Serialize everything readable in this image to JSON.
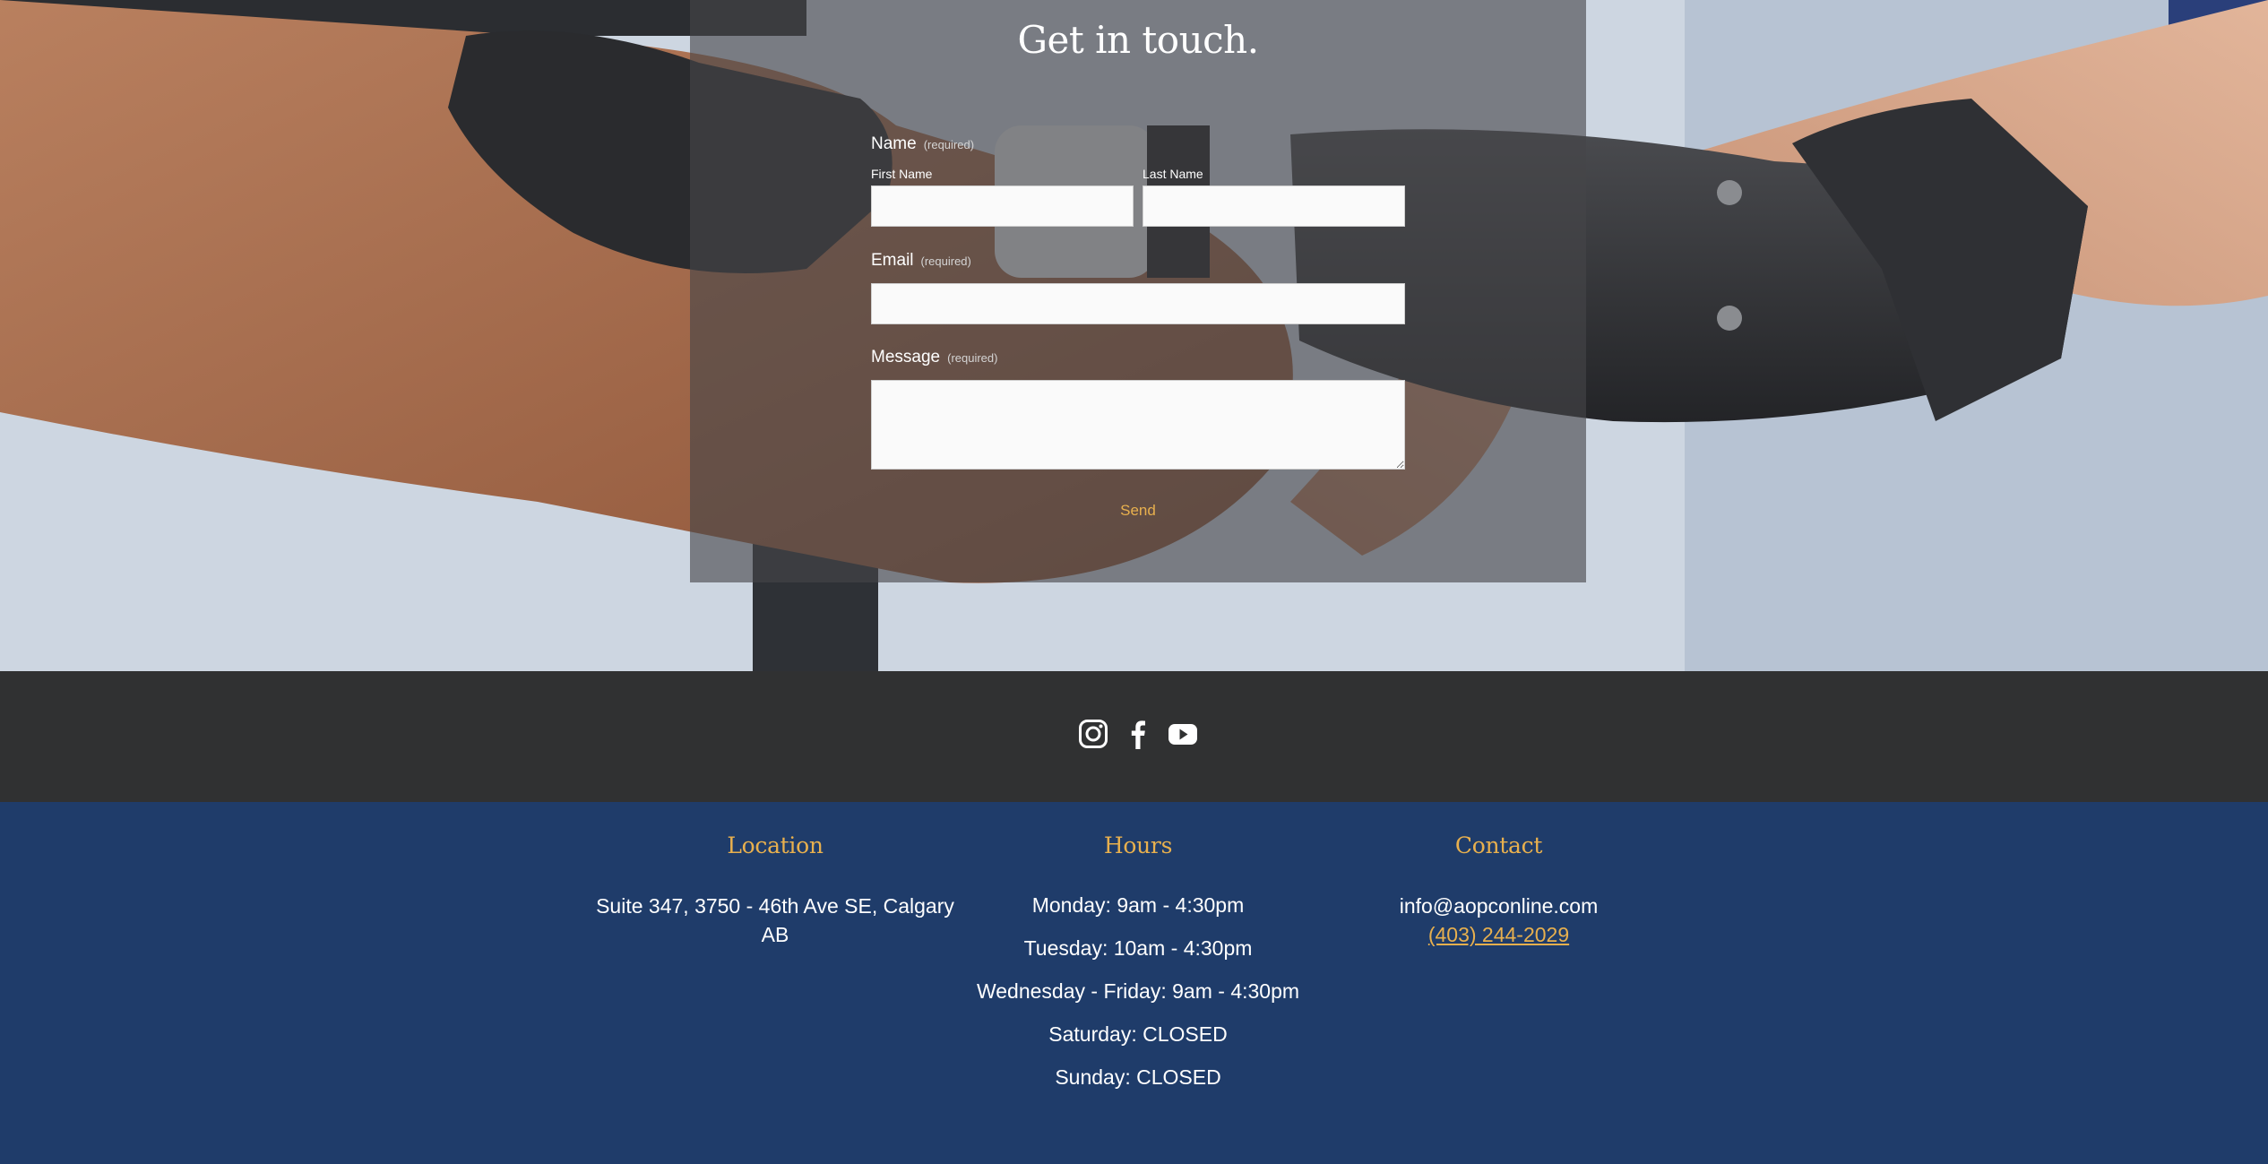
{
  "form": {
    "title": "Get in touch.",
    "name_label": "Name",
    "name_required": "(required)",
    "first_name_label": "First Name",
    "first_name_value": "",
    "last_name_label": "Last Name",
    "last_name_value": "",
    "email_label": "Email",
    "email_required": "(required)",
    "email_value": "",
    "message_label": "Message",
    "message_required": "(required)",
    "message_value": "",
    "send_label": "Send"
  },
  "social": {
    "icons": [
      "instagram-icon",
      "facebook-icon",
      "youtube-icon"
    ]
  },
  "footer": {
    "location": {
      "heading": "Location",
      "address": "Suite 347, 3750 - 46th Ave SE, Calgary AB"
    },
    "hours": {
      "heading": "Hours",
      "lines": [
        "Monday: 9am - 4:30pm",
        "Tuesday: 10am - 4:30pm",
        "Wednesday - Friday: 9am - 4:30pm",
        "Saturday: CLOSED",
        "Sunday: CLOSED"
      ]
    },
    "contact": {
      "heading": "Contact",
      "email": "info@aopconline.com",
      "phone": "(403) 244-2029"
    }
  },
  "colors": {
    "accent": "#e8b04e",
    "social_bar": "#303132",
    "footer_bg": "#1f3c6a",
    "panel_overlay": "rgba(70,70,72,0.62)"
  }
}
